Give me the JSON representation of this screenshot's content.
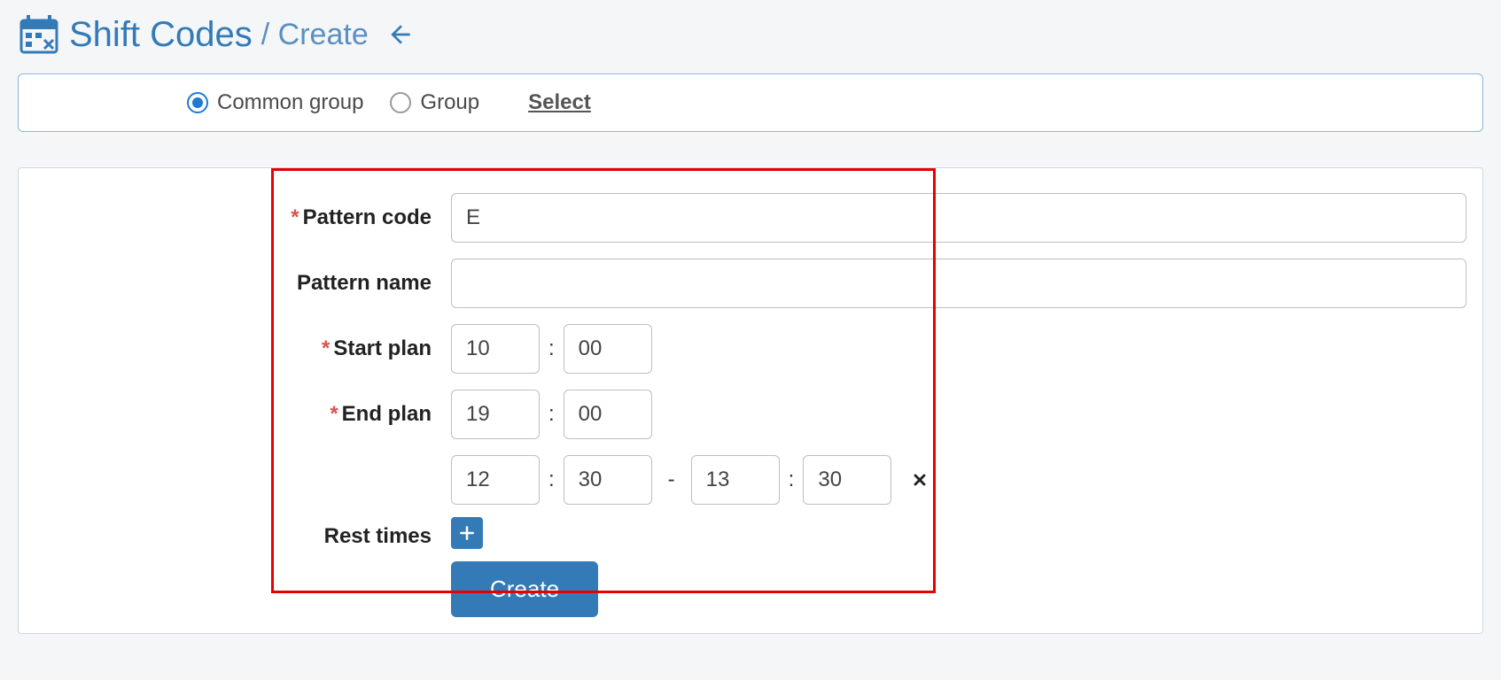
{
  "header": {
    "title": "Shift Codes",
    "sub": "/ Create"
  },
  "panel": {
    "common_label": "Common group",
    "group_label": "Group",
    "select_label": "Select"
  },
  "form": {
    "pattern_code": {
      "label": "Pattern code",
      "value": "E"
    },
    "pattern_name": {
      "label": "Pattern name",
      "value": ""
    },
    "start_plan": {
      "label": "Start plan",
      "hh": "10",
      "mm": "00"
    },
    "end_plan": {
      "label": "End plan",
      "hh": "19",
      "mm": "00"
    },
    "rest_times": {
      "label": "Rest times",
      "from_hh": "12",
      "from_mm": "30",
      "to_hh": "13",
      "to_mm": "30"
    },
    "create_label": "Create"
  },
  "sep": {
    "colon": ":",
    "dash": "-"
  }
}
